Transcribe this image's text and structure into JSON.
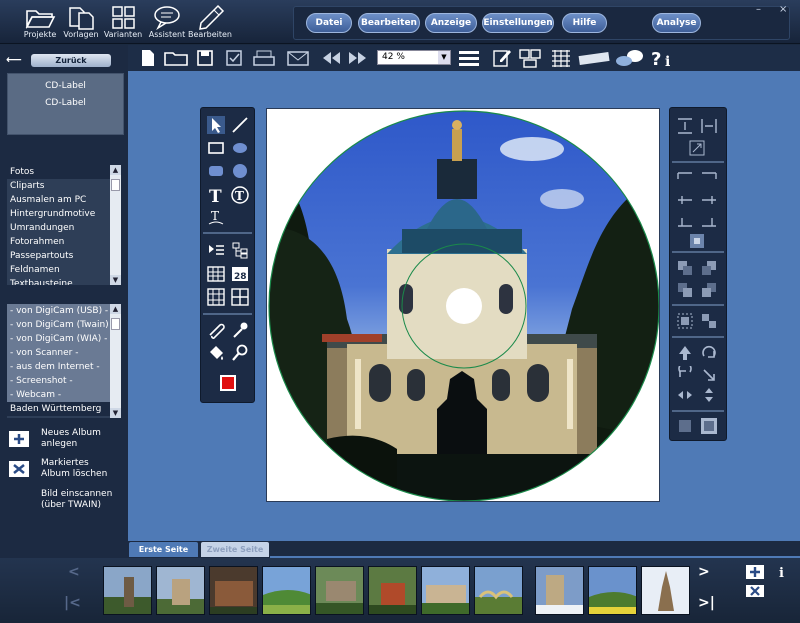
{
  "topbar": {
    "buttons": [
      {
        "label": "Projekte",
        "icon": "folder-open-icon"
      },
      {
        "label": "Vorlagen",
        "icon": "documents-icon"
      },
      {
        "label": "Varianten",
        "icon": "grid-icon"
      },
      {
        "label": "Assistent",
        "icon": "speech-bubble-icon"
      },
      {
        "label": "Bearbeiten",
        "icon": "pen-icon"
      }
    ],
    "menu": [
      "Datei",
      "Bearbeiten",
      "Anzeige",
      "Einstellungen",
      "Hilfe"
    ],
    "analyse": "Analyse",
    "window_controls": [
      "–",
      "×"
    ]
  },
  "toolbar2": {
    "zoom": "42 %"
  },
  "left": {
    "back_label": "Zurück",
    "cd_label_1": "CD-Label",
    "cd_label_2": "CD-Label",
    "categories": [
      "Fotos",
      "Cliparts",
      "Ausmalen am PC",
      "Hintergrundmotive",
      "Umrandungen",
      "Fotorahmen",
      "Passepartouts",
      "Feldnamen",
      "Textbausteine"
    ],
    "sources": [
      "- von DigiCam (USB) -",
      "- von DigiCam (Twain) -",
      "- von DigiCam (WIA) -",
      "- von Scanner -",
      "- aus dem Internet -",
      "- Screenshot -",
      "- Webcam -",
      "Baden Württemberg"
    ],
    "new_album_1": "Neues Album",
    "new_album_2": "anlegen",
    "del_album_1": "Markiertes",
    "del_album_2": "Album löschen",
    "scan_1": "Bild einscannen",
    "scan_2": "(über TWAIN)"
  },
  "tabs": [
    "Erste Seite",
    "Zweite Seite"
  ],
  "colors": {
    "workspace": "#4f7ab6",
    "panel": "#1c2a42",
    "accent_red": "#e01010"
  },
  "filmstrip": {
    "count": 11,
    "info": "i"
  }
}
